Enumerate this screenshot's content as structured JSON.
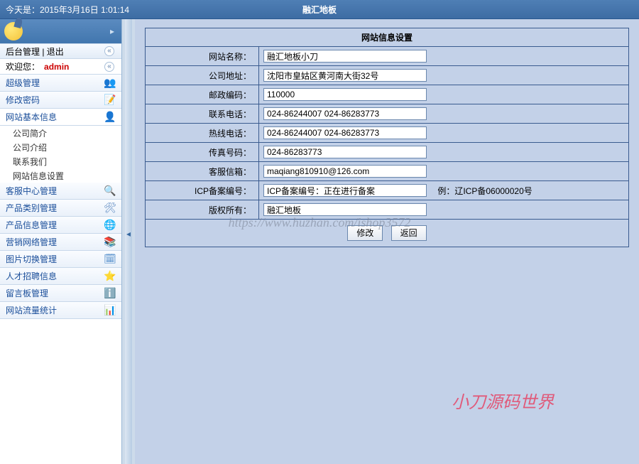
{
  "header": {
    "date_prefix": "今天是：",
    "date_value": "2015年3月16日 1:01:14",
    "app_title": "融汇地板"
  },
  "sidebar": {
    "manage_label": "后台管理  |  退出",
    "welcome_label": "欢迎您：",
    "username": "admin",
    "nav": {
      "super": "超级管理",
      "pwd": "修改密码",
      "siteinfo": "网站基本信息",
      "sub_company_brief": "公司简介",
      "sub_company_intro": "公司介绍",
      "sub_contact": "联系我们",
      "sub_site_settings": "网站信息设置",
      "cs_center": "客服中心管理",
      "prod_cat": "产品类别管理",
      "prod_info": "产品信息管理",
      "marketing": "营销网络管理",
      "img_switch": "图片切换管理",
      "recruit": "人才招聘信息",
      "guestbook": "留言板管理",
      "traffic": "网站流量统计"
    }
  },
  "form": {
    "title": "网站信息设置",
    "labels": {
      "site_name": "网站名称：",
      "company_addr": "公司地址：",
      "postal": "邮政编码：",
      "phone": "联系电话：",
      "hotline": "热线电话：",
      "fax": "传真号码：",
      "cs_email": "客服信箱：",
      "icp": "ICP备案编号：",
      "copyright": "版权所有："
    },
    "values": {
      "site_name": "融汇地板小刀",
      "company_addr": "沈阳市皇姑区黄河南大街32号",
      "postal": "110000",
      "phone": "024-86244007 024-86283773",
      "hotline": "024-86244007 024-86283773",
      "fax": "024-86283773",
      "cs_email": "maqiang810910@126.com",
      "icp": "ICP备案编号：正在进行备案",
      "copyright": "融汇地板"
    },
    "icp_hint": "例：辽ICP备06000020号",
    "buttons": {
      "modify": "修改",
      "back": "返回"
    }
  },
  "watermarks": {
    "url": "https://www.huzhan.com/ishop3572",
    "brand": "小刀源码世界"
  },
  "colors": {
    "header_bg": "#3d6ca3",
    "panel_bg": "#c3d1e8",
    "border": "#3a5b8f"
  }
}
